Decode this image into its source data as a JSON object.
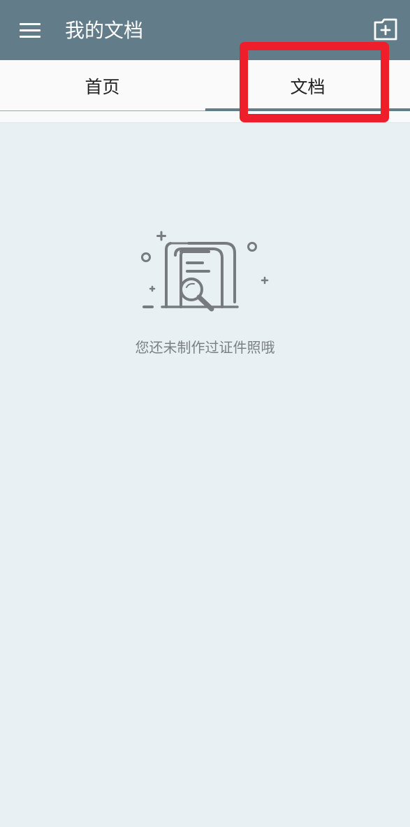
{
  "app_bar": {
    "title": "我的文档",
    "menu_icon": "menu-icon",
    "action_icon": "add-folder-icon",
    "background_color": "#637c8a"
  },
  "tabs": [
    {
      "label": "首页",
      "selected": false
    },
    {
      "label": "文档",
      "selected": true
    }
  ],
  "highlight": {
    "target": "tab-documents",
    "color": "#ee1e2a"
  },
  "empty_state": {
    "icon": "empty-documents-search-icon",
    "message": "您还未制作过证件照哦"
  }
}
